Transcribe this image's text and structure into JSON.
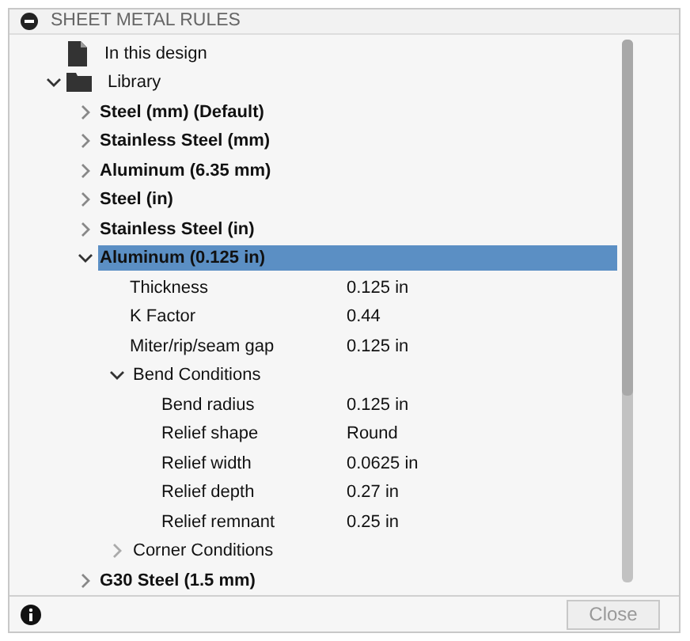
{
  "panel": {
    "title": "SHEET METAL RULES"
  },
  "tree": [
    {
      "kind": "file",
      "label": "In this design"
    },
    {
      "kind": "folder",
      "label": "Library",
      "expanded": true,
      "children": [
        {
          "kind": "rule",
          "label": "Steel (mm) (Default)",
          "expanded": false,
          "selected": false
        },
        {
          "kind": "rule",
          "label": "Stainless Steel (mm)",
          "expanded": false,
          "selected": false
        },
        {
          "kind": "rule",
          "label": "Aluminum (6.35 mm)",
          "expanded": false,
          "selected": false
        },
        {
          "kind": "rule",
          "label": "Steel (in)",
          "expanded": false,
          "selected": false
        },
        {
          "kind": "rule",
          "label": "Stainless Steel (in)",
          "expanded": false,
          "selected": false
        },
        {
          "kind": "rule",
          "label": "Aluminum (0.125 in)",
          "expanded": true,
          "selected": true,
          "children": [
            {
              "kind": "property",
              "name": "Thickness",
              "value": "0.125 in"
            },
            {
              "kind": "property",
              "name": "K Factor",
              "value": "0.44"
            },
            {
              "kind": "property",
              "name": "Miter/rip/seam gap",
              "value": "0.125 in"
            },
            {
              "kind": "group",
              "label": "Bend Conditions",
              "expanded": true,
              "children": [
                {
                  "kind": "property",
                  "name": "Bend radius",
                  "value": "0.125 in"
                },
                {
                  "kind": "property",
                  "name": "Relief shape",
                  "value": "Round"
                },
                {
                  "kind": "property",
                  "name": "Relief width",
                  "value": "0.0625 in"
                },
                {
                  "kind": "property",
                  "name": "Relief depth",
                  "value": "0.27 in"
                },
                {
                  "kind": "property",
                  "name": "Relief remnant",
                  "value": "0.25 in"
                }
              ]
            },
            {
              "kind": "group",
              "label": "Corner Conditions",
              "expanded": false
            }
          ]
        },
        {
          "kind": "rule",
          "label": "G30 Steel (1.5 mm)",
          "expanded": false,
          "selected": false
        }
      ]
    }
  ],
  "footer": {
    "button": {
      "label": "Close",
      "disabled": true
    }
  }
}
